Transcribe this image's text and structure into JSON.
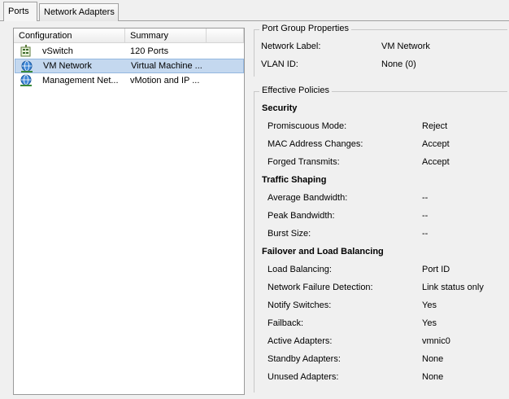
{
  "tabs": [
    {
      "label": "Ports"
    },
    {
      "label": "Network Adapters"
    }
  ],
  "list": {
    "columns": [
      "Configuration",
      "Summary"
    ],
    "rows": [
      {
        "icon": "vswitch-icon",
        "configuration": "vSwitch",
        "summary": "120 Ports"
      },
      {
        "icon": "vm-network-icon",
        "configuration": "VM Network",
        "summary": "Virtual Machine ..."
      },
      {
        "icon": "management-network-icon",
        "configuration": "Management Net...",
        "summary": "vMotion and IP ..."
      }
    ]
  },
  "port_group": {
    "title": "Port Group Properties",
    "props": [
      {
        "label": "Network Label:",
        "value": "VM Network"
      },
      {
        "label": "VLAN ID:",
        "value": "None (0)"
      }
    ]
  },
  "policies": {
    "title": "Effective Policies",
    "sections": [
      {
        "title": "Security",
        "props": [
          {
            "label": "Promiscuous Mode:",
            "value": "Reject"
          },
          {
            "label": "MAC Address Changes:",
            "value": "Accept"
          },
          {
            "label": "Forged Transmits:",
            "value": "Accept"
          }
        ]
      },
      {
        "title": "Traffic Shaping",
        "props": [
          {
            "label": "Average Bandwidth:",
            "value": "--"
          },
          {
            "label": "Peak Bandwidth:",
            "value": "--"
          },
          {
            "label": "Burst Size:",
            "value": "--"
          }
        ]
      },
      {
        "title": "Failover and Load Balancing",
        "props": [
          {
            "label": "Load Balancing:",
            "value": "Port ID"
          },
          {
            "label": "Network Failure Detection:",
            "value": "Link status only"
          },
          {
            "label": "Notify Switches:",
            "value": "Yes"
          },
          {
            "label": "Failback:",
            "value": "Yes"
          },
          {
            "label": "Active Adapters:",
            "value": "vmnic0"
          },
          {
            "label": "Standby Adapters:",
            "value": "None"
          },
          {
            "label": "Unused Adapters:",
            "value": "None"
          }
        ]
      }
    ]
  }
}
